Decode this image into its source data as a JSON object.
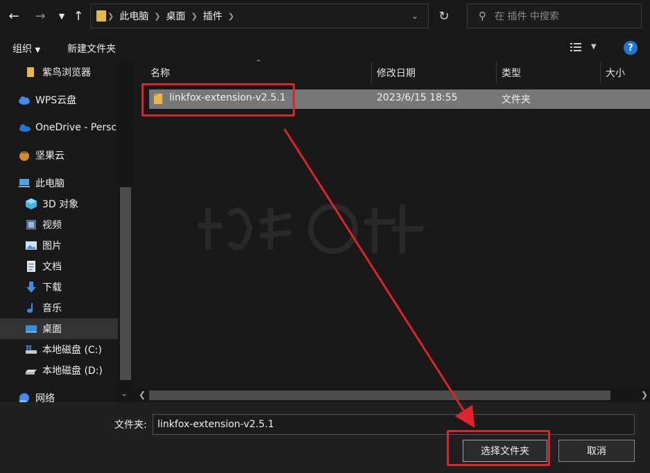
{
  "address": {
    "crumbs": [
      "此电脑",
      "桌面",
      "插件"
    ]
  },
  "search": {
    "placeholder": "在 插件 中搜索"
  },
  "toolbar": {
    "organize": "组织",
    "new_folder": "新建文件夹",
    "help": "?"
  },
  "sidebar": {
    "items": [
      {
        "label": "紫鸟浏览器",
        "icon": "folder-icon"
      },
      {
        "label": "WPS云盘",
        "icon": "cloud-icon"
      },
      {
        "label": "OneDrive - Persc",
        "icon": "onedrive-icon"
      },
      {
        "label": "坚果云",
        "icon": "nut-icon"
      },
      {
        "label": "此电脑",
        "icon": "computer-icon"
      },
      {
        "label": "3D 对象",
        "icon": "cube-icon"
      },
      {
        "label": "视频",
        "icon": "video-icon"
      },
      {
        "label": "图片",
        "icon": "picture-icon"
      },
      {
        "label": "文档",
        "icon": "document-icon"
      },
      {
        "label": "下载",
        "icon": "download-icon"
      },
      {
        "label": "音乐",
        "icon": "music-icon"
      },
      {
        "label": "桌面",
        "icon": "desktop-icon"
      },
      {
        "label": "本地磁盘 (C:)",
        "icon": "drive-c-icon"
      },
      {
        "label": "本地磁盘 (D:)",
        "icon": "drive-d-icon"
      },
      {
        "label": "网络",
        "icon": "network-icon"
      }
    ]
  },
  "columns": [
    "名称",
    "修改日期",
    "类型",
    "大小"
  ],
  "files": [
    {
      "name": "linkfox-extension-v2.5.1",
      "modified": "2023/6/15 18:55",
      "type": "文件夹",
      "size": ""
    }
  ],
  "footer": {
    "folder_label": "文件夹:",
    "folder_value": "linkfox-extension-v2.5.1",
    "select_button": "选择文件夹",
    "cancel_button": "取消"
  },
  "colors": {
    "accent": "#1e78d4",
    "annotation": "#e0242b",
    "folder": "#e8b949"
  }
}
